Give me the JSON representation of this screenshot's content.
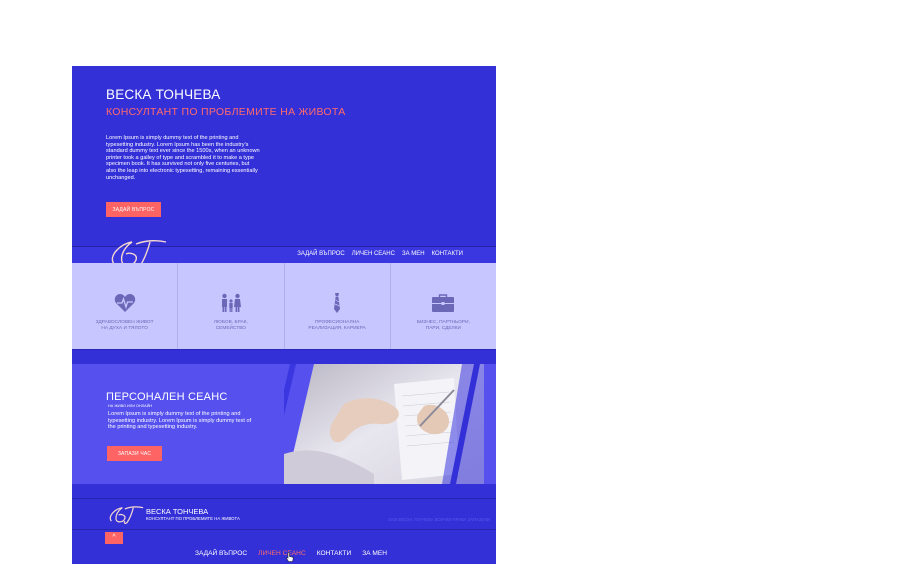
{
  "hero": {
    "name": "ВЕСКА ТОНЧЕВА",
    "subtitle": "КОНСУЛТАНТ ПО ПРОБЛЕМИТЕ НА ЖИВОТА",
    "text": "Lorem Ipsum is simply dummy text of the printing and typesetting industry. Lorem Ipsum has been the industry's standard dummy text ever since the 1500s, when an unknown printer took a galley of type and scrambled it to make a type specimen book. It has survived not only five centuries, but also the leap into electronic typesetting, remaining essentially unchanged.",
    "button": "ЗАДАЙ ВЪПРОС"
  },
  "logo": {
    "text": "ВТ"
  },
  "nav": [
    "ЗАДАЙ ВЪПРОС",
    "ЛИЧЕН СЕАНС",
    "ЗА МЕН",
    "КОНТАКТИ"
  ],
  "features": [
    {
      "icon": "heartbeat-icon",
      "label1": "ЗДРАВОСЛОВЕН ЖИВОТ",
      "label2": "НА ДУХА И ТЯЛОТО"
    },
    {
      "icon": "family-icon",
      "label1": "ЛЮБОВ, БРАК,",
      "label2": "СЕМЕЙСТВО"
    },
    {
      "icon": "tie-icon",
      "label1": "ПРОФЕСИОНАЛНА",
      "label2": "РЕАЛИЗАЦИЯ, КАРИЕРА"
    },
    {
      "icon": "briefcase-icon",
      "label1": "БИЗНЕС, ПАРТНЬОРИ,",
      "label2": "ПАРИ, СДЕЛКИ"
    }
  ],
  "session": {
    "title": "ПЕРСОНАЛЕН СЕАНС",
    "tag": "НА ЖИВО ИЛИ ОНЛАЙН",
    "text": "Lorem Ipsum is simply dummy text of the printing and typesetting industry. Lorem Ipsum is simply dummy text of the printing and typesetting industry.",
    "button": "ЗАПАЗИ ЧАС"
  },
  "footer": {
    "name": "ВЕСКА ТОНЧЕВА",
    "subtitle": "КОНСУЛТАНТ ПО ПРОБЛЕМИТЕ НА ЖИВОТА",
    "copyright": "2015 ВЕСКА ТОНЧЕВА ВСИЧКИ ПРАВА ЗАПАЗЕНИ",
    "up_icon": "^",
    "nav": [
      "ЗАДАЙ ВЪПРОС",
      "ЛИЧЕН СЕАНС",
      "КОНТАКТИ",
      "ЗА МЕН"
    ],
    "active_index": 1
  },
  "colors": {
    "primary": "#3430d8",
    "accent": "#ff6464",
    "light": "#c8c6ff",
    "session": "#5550ee"
  }
}
